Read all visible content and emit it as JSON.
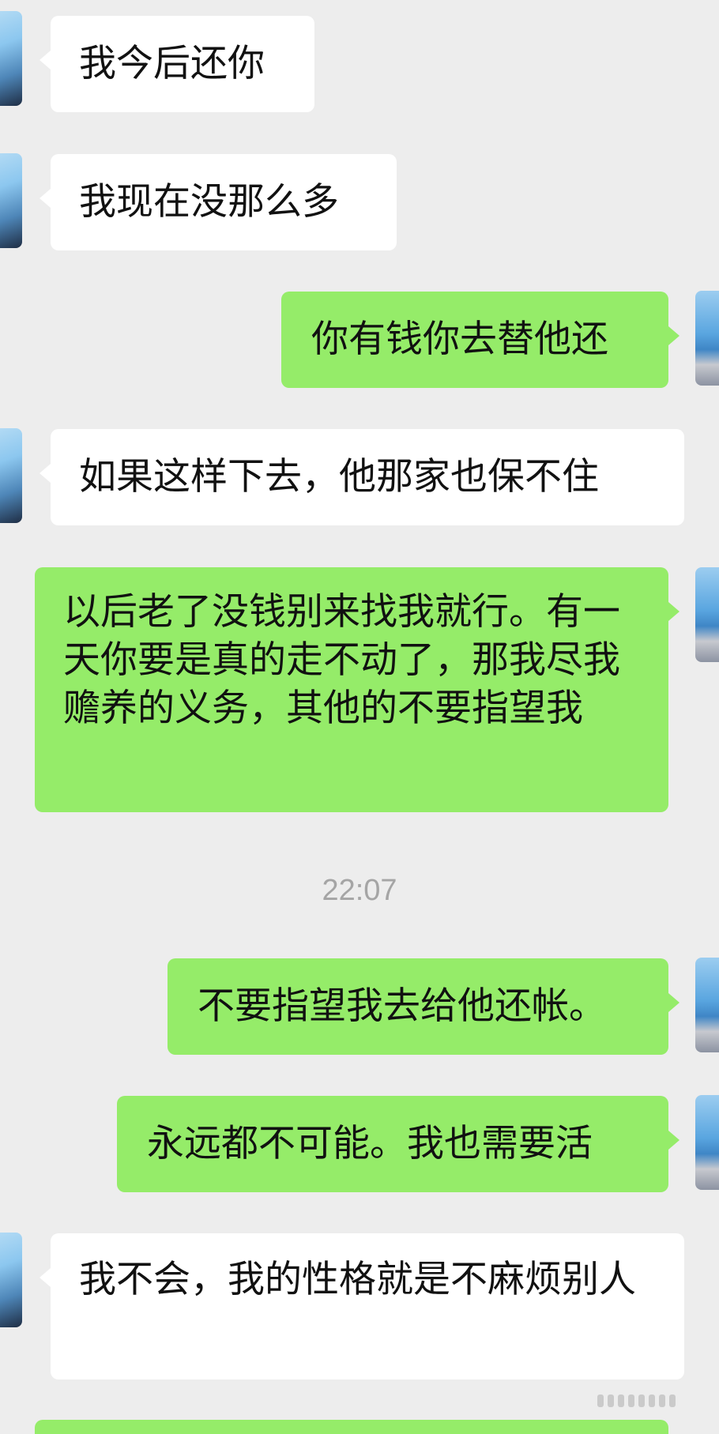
{
  "messages": [
    {
      "side": "in",
      "text": "我今后还你"
    },
    {
      "side": "in",
      "text": "我现在没那么多"
    },
    {
      "side": "out",
      "text": "你有钱你去替他还"
    },
    {
      "side": "in",
      "text": "如果这样下去，他那家也保不住"
    },
    {
      "side": "out",
      "text": "以后老了没钱别来找我就行。有一天你要是真的走不动了，那我尽我赡养的义务，其他的不要指望我"
    },
    {
      "side": "out",
      "text": "不要指望我去给他还帐。"
    },
    {
      "side": "out",
      "text": "永远都不可能。我也需要活"
    },
    {
      "side": "in",
      "text": "我不会，我的性格就是不麻烦别人"
    }
  ],
  "timestamp": "22:07",
  "colors": {
    "background": "#ededed",
    "incoming_bubble": "#ffffff",
    "outgoing_bubble": "#95ec69",
    "timestamp_text": "#a5a5a5"
  },
  "icons": {
    "incoming_avatar": "contact-avatar-icon",
    "outgoing_avatar": "self-avatar-icon"
  }
}
